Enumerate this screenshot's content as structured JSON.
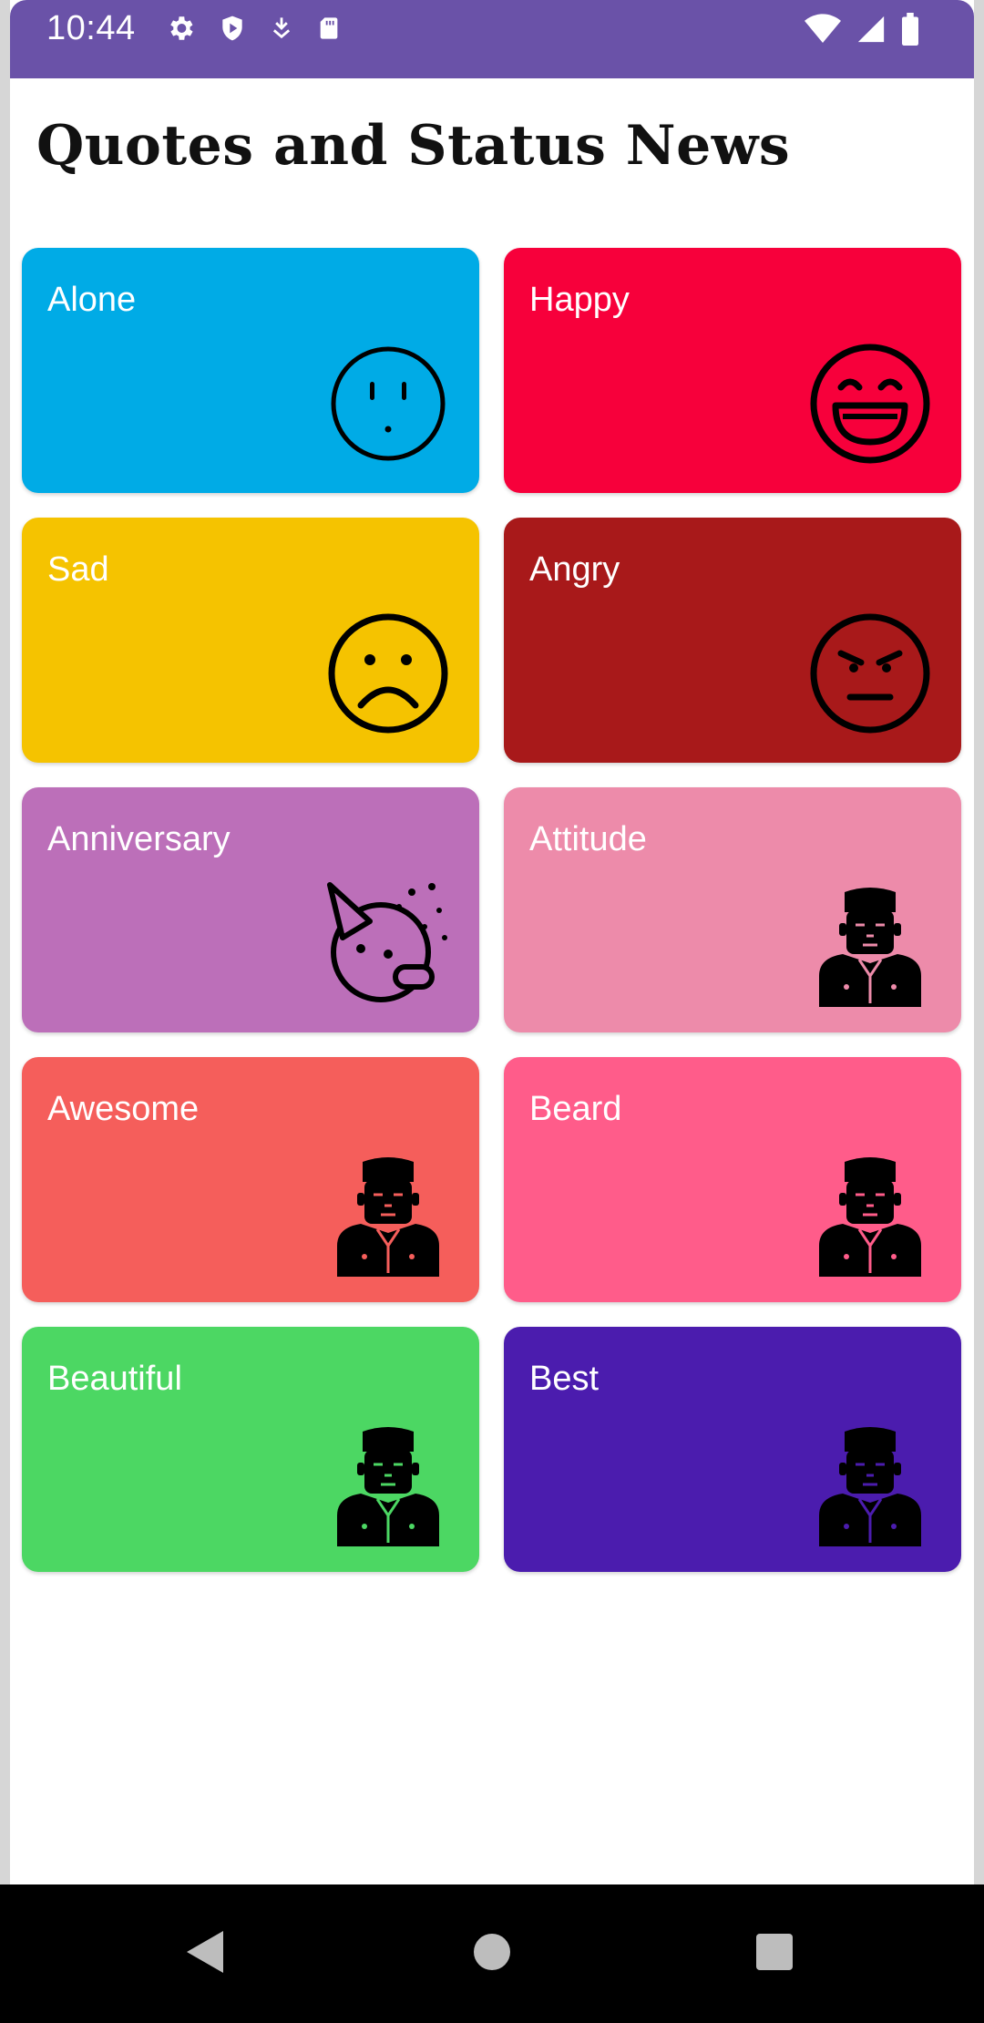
{
  "status_bar": {
    "time": "10:44",
    "left_icons": [
      "settings-icon",
      "shield-icon",
      "download-icon",
      "sd-card-icon"
    ],
    "right_icons": [
      "wifi-icon",
      "signal-icon",
      "battery-icon"
    ],
    "color": "#6A52A8"
  },
  "app": {
    "title": "Quotes and Status News"
  },
  "categories": [
    {
      "label": "Alone",
      "color": "#00ABE6",
      "icon": "neutral-face-icon"
    },
    {
      "label": "Happy",
      "color": "#F7003B",
      "icon": "grinning-face-icon"
    },
    {
      "label": "Sad",
      "color": "#F5C300",
      "icon": "sad-face-icon"
    },
    {
      "label": "Angry",
      "color": "#A8191A",
      "icon": "angry-face-icon"
    },
    {
      "label": "Anniversary",
      "color": "#BC6FB9",
      "icon": "party-face-icon"
    },
    {
      "label": "Attitude",
      "color": "#ED8BAA",
      "icon": "man-suit-icon"
    },
    {
      "label": "Awesome",
      "color": "#F55E5B",
      "icon": "man-suit-icon"
    },
    {
      "label": "Beard",
      "color": "#FF5C8A",
      "icon": "man-suit-icon"
    },
    {
      "label": "Beautiful",
      "color": "#4CD763",
      "icon": "man-suit-icon"
    },
    {
      "label": "Best",
      "color": "#4B1CAE",
      "icon": "man-suit-icon"
    }
  ],
  "nav_bar": {
    "buttons": [
      "back-icon",
      "home-icon",
      "recents-icon"
    ]
  }
}
